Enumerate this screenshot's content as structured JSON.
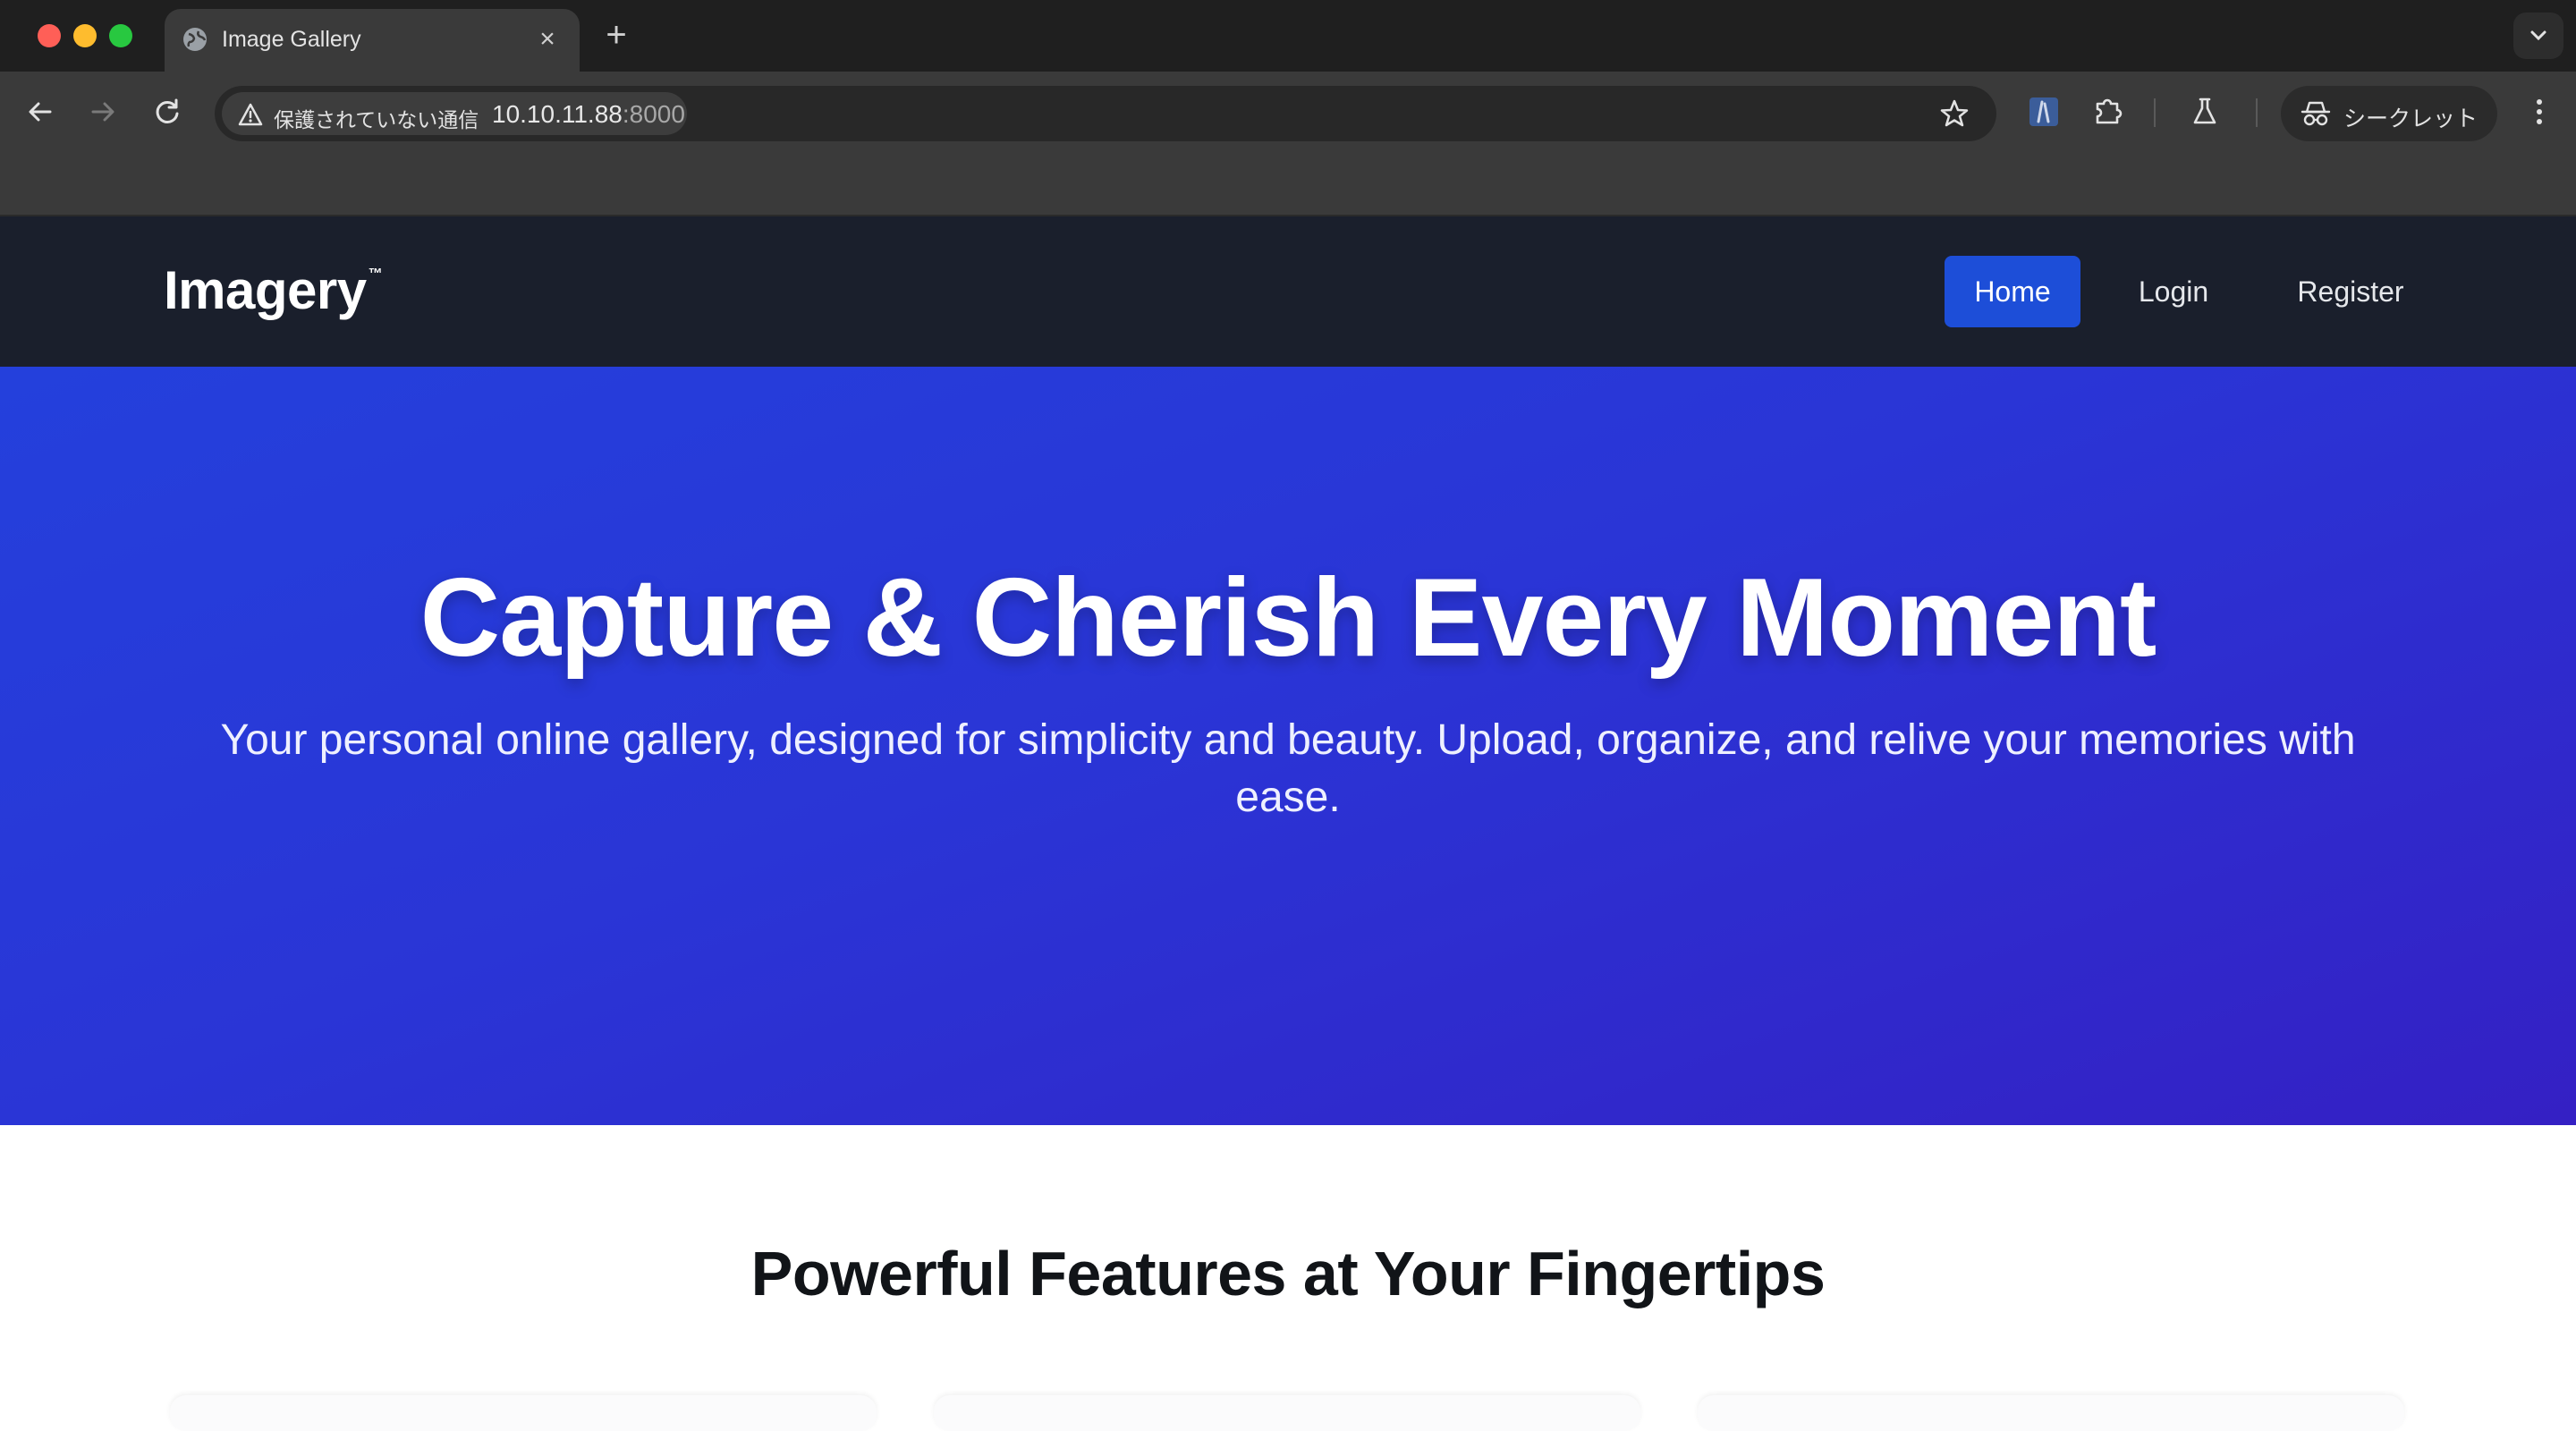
{
  "browser": {
    "tab": {
      "title": "Image Gallery",
      "favicon": "globe-icon"
    },
    "address": {
      "security_label": "保護されていない通信",
      "host": "10.10.11.88",
      "port": ":8000"
    },
    "incognito_label": "シークレット"
  },
  "site": {
    "brand": "Imagery",
    "brand_mark": "™",
    "nav": [
      {
        "label": "Home",
        "active": true
      },
      {
        "label": "Login",
        "active": false
      },
      {
        "label": "Register",
        "active": false
      }
    ],
    "hero": {
      "title": "Capture & Cherish Every Moment",
      "subtitle": "Your personal online gallery, designed for simplicity and beauty. Upload, organize, and relive your memories with ease."
    },
    "features": {
      "title": "Powerful Features at Your Fingertips"
    }
  },
  "colors": {
    "nav_bg": "#1a1f2c",
    "accent": "#1d4ed8",
    "hero_start": "#2440dc",
    "hero_end": "#3420c4"
  }
}
